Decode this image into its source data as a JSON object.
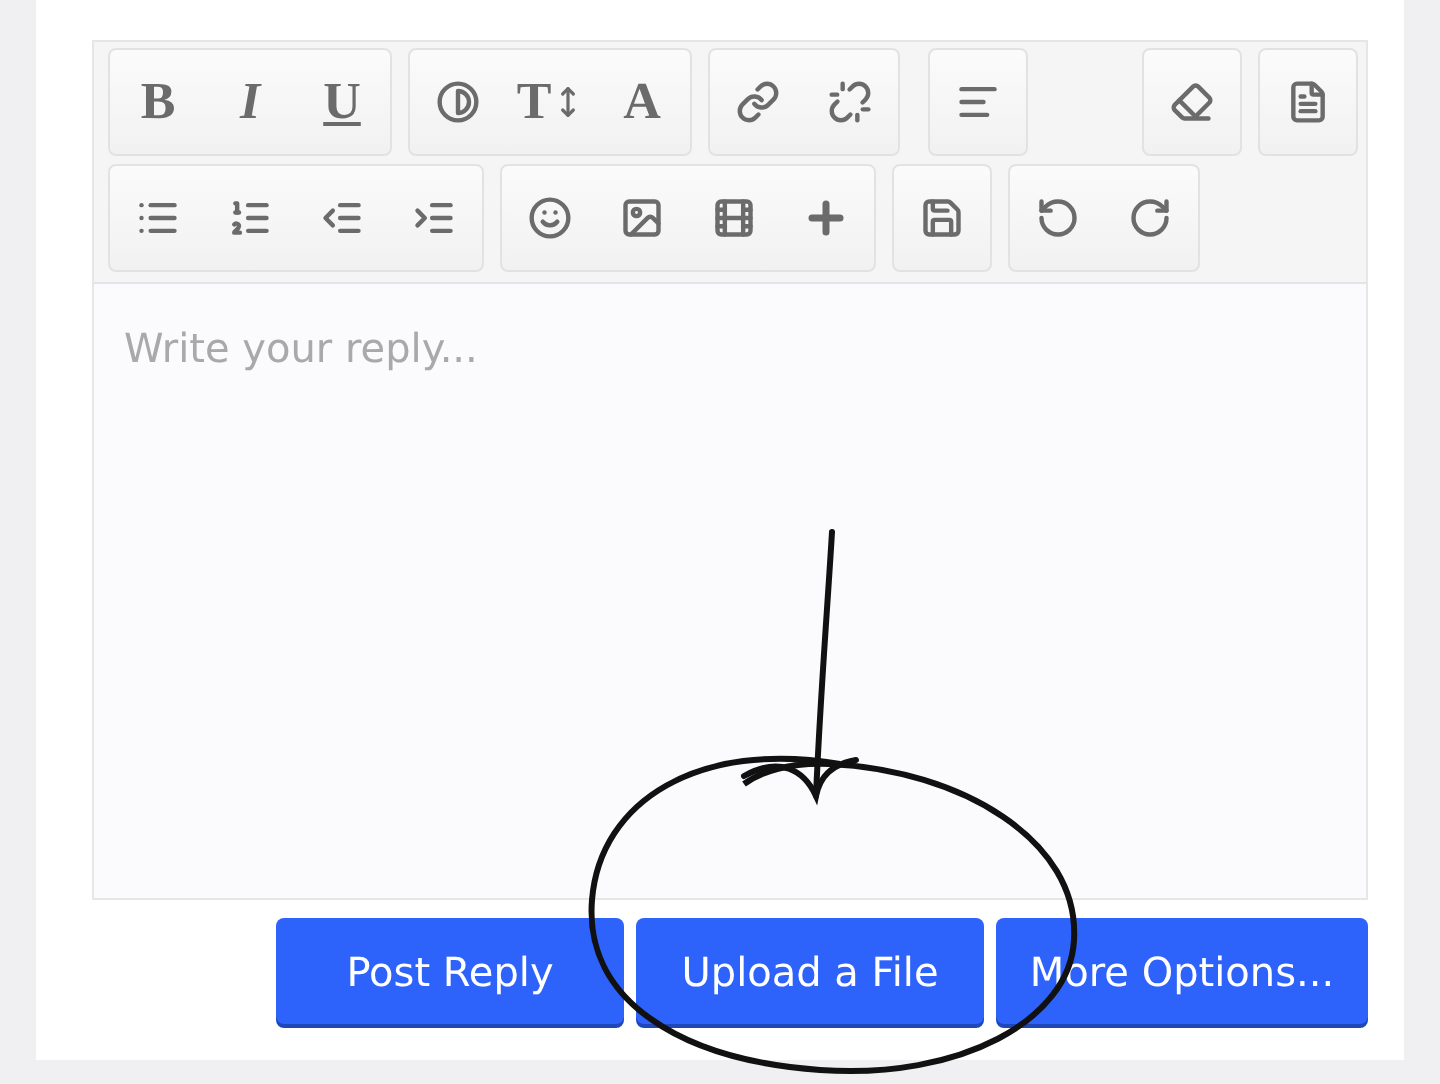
{
  "editor": {
    "toolbar_letters": [
      "B",
      "I",
      "U",
      "T",
      "A"
    ],
    "reply": {
      "placeholder": "Write your reply..."
    }
  },
  "buttons": [
    "Post Reply",
    "Upload a File",
    "More Options..."
  ]
}
